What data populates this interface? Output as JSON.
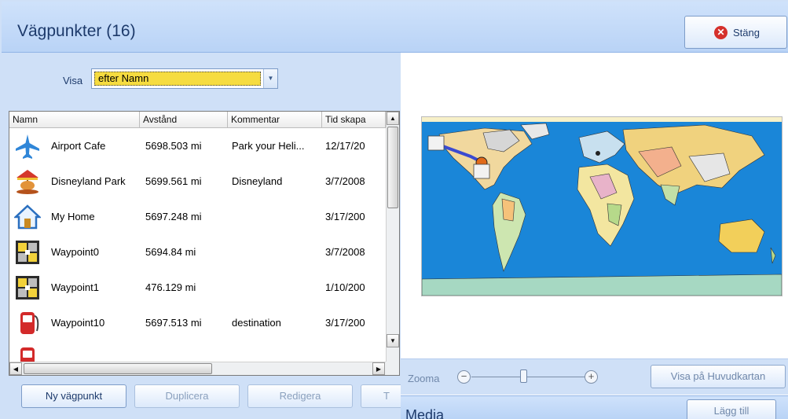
{
  "window": {
    "title": "Vägpunkter (16)",
    "close_label": "Stäng"
  },
  "filter": {
    "label": "Visa",
    "selected": "efter Namn"
  },
  "table": {
    "columns": [
      "Namn",
      "Avstånd",
      "Kommentar",
      "Tid skapa"
    ],
    "rows": [
      {
        "icon": "airplane-icon",
        "name": "Airport Cafe",
        "distance": "5698.503 mi",
        "comment": "Park your Heli...",
        "time": "12/17/20"
      },
      {
        "icon": "carousel-icon",
        "name": "Disneyland Park",
        "distance": "5699.561 mi",
        "comment": "Disneyland",
        "time": "3/7/2008"
      },
      {
        "icon": "home-icon",
        "name": "My Home",
        "distance": "5697.248 mi",
        "comment": "",
        "time": "3/17/200"
      },
      {
        "icon": "waypoint-icon",
        "name": "Waypoint0",
        "distance": "5694.84 mi",
        "comment": "",
        "time": "3/7/2008"
      },
      {
        "icon": "waypoint-icon",
        "name": "Waypoint1",
        "distance": "476.129 mi",
        "comment": "",
        "time": "1/10/200"
      },
      {
        "icon": "fuel-pump-icon",
        "name": "Waypoint10",
        "distance": "5697.513 mi",
        "comment": "destination",
        "time": "3/17/200"
      }
    ]
  },
  "actions": {
    "new": "Ny vägpunkt",
    "duplicate": "Duplicera",
    "edit": "Redigera",
    "truncated": "T"
  },
  "map": {
    "zoom_label": "Zooma",
    "zoom_minus": "−",
    "zoom_plus": "+",
    "show_main": "Visa på Huvudkartan"
  },
  "media": {
    "title": "Media",
    "add": "Lägg till"
  },
  "colors": {
    "header_bg": "#c3d9f8",
    "selection_yellow": "#f6dc40",
    "close_red": "#d5302b",
    "ocean": "#1a86d8"
  }
}
